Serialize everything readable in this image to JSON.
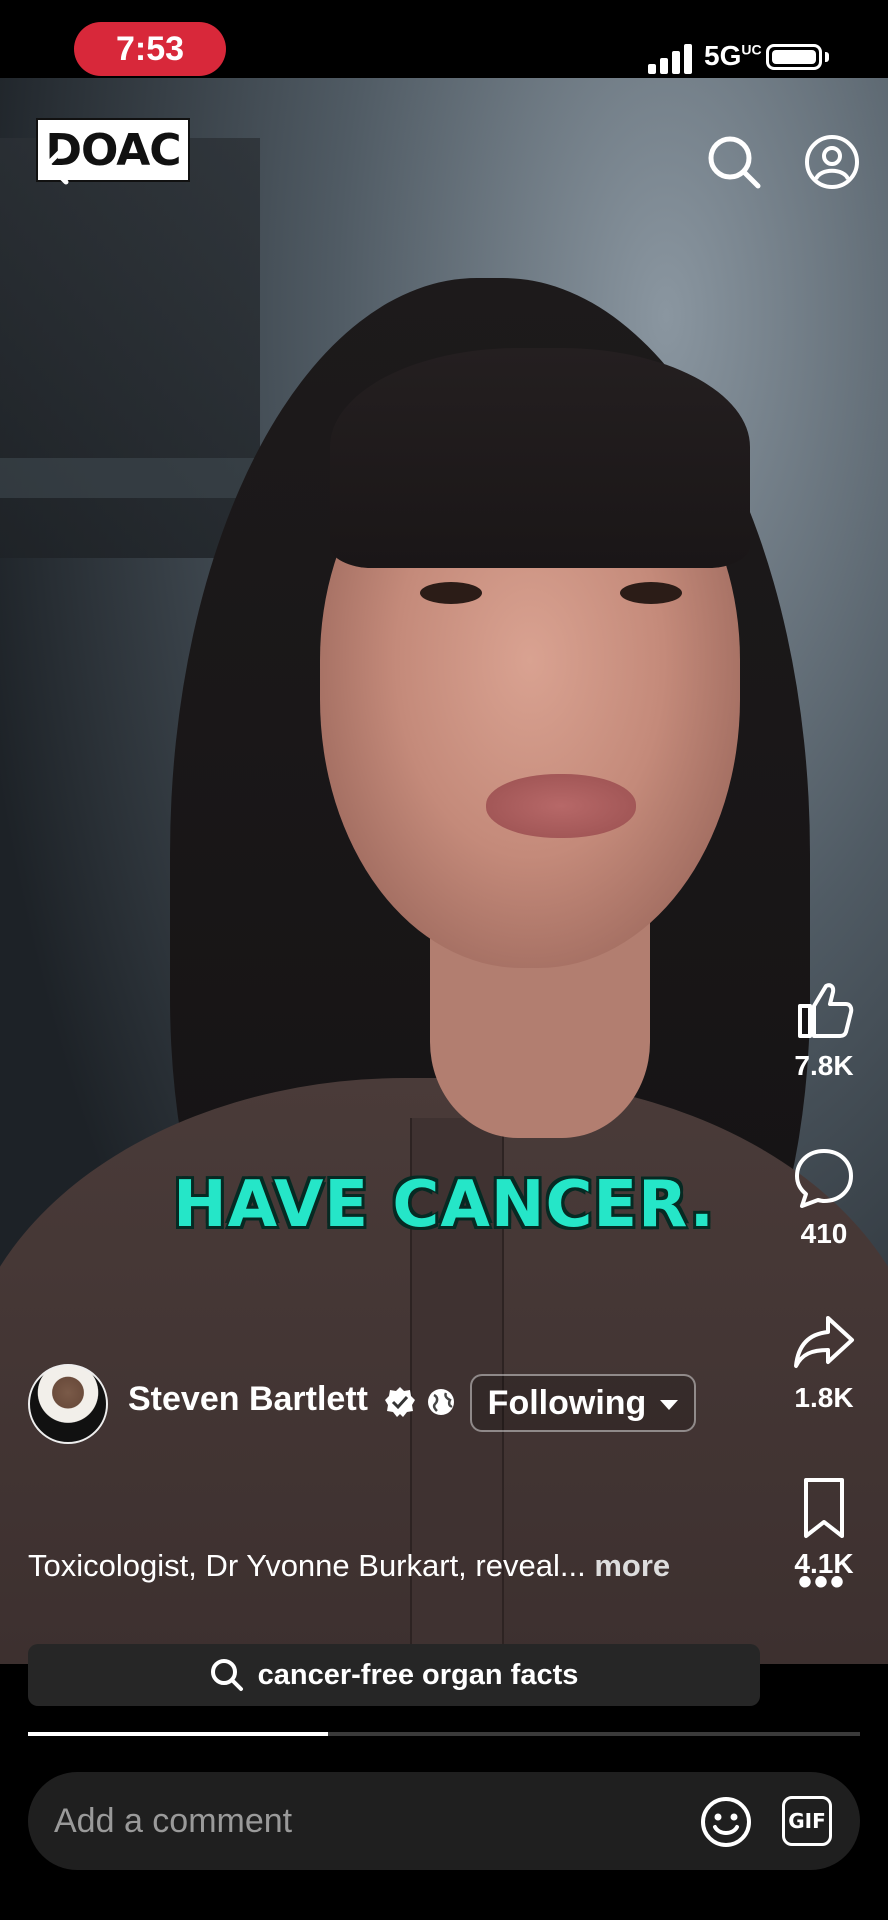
{
  "status_bar": {
    "time": "7:53",
    "network": "5G",
    "network_super": "UC"
  },
  "video": {
    "channel_logo": "DOAC",
    "caption": "HAVE CANCER.",
    "progress": 0.36
  },
  "actions": {
    "likes": "7.8K",
    "comments": "410",
    "shares": "1.8K",
    "saves": "4.1K"
  },
  "author": {
    "name": "Steven Bartlett",
    "follow_label": "Following"
  },
  "description": {
    "text": "Toxicologist, Dr Yvonne Burkart, reveal...",
    "more_label": "more"
  },
  "search_suggestion": {
    "label": "cancer-free organ facts"
  },
  "comment": {
    "placeholder": "Add a comment",
    "gif_label": "GIF"
  },
  "colors": {
    "time_pill": "#d8283a",
    "caption": "#25e6c8"
  }
}
